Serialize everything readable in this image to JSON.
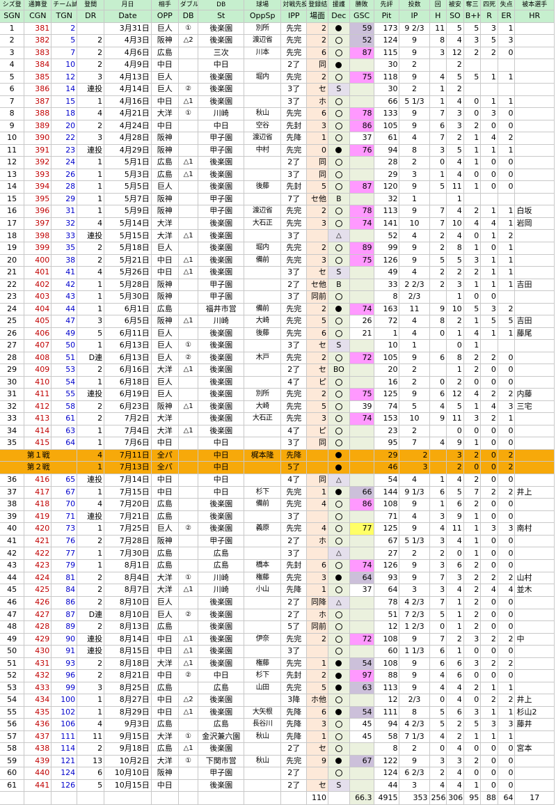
{
  "headers_jp": [
    "シズ登",
    "通算登",
    "チーム試",
    "登間",
    "月日",
    "相手",
    "ダブル",
    "DB",
    "球場",
    "対戦先投",
    "登録結果",
    "援護",
    "勝敗",
    "先評",
    "投数",
    "回",
    "被安",
    "奪三",
    "四死",
    "失点",
    "自責",
    "被本選手"
  ],
  "headers_en": [
    "SGN",
    "CGN",
    "TGN",
    "DR",
    "Date",
    "OPP",
    "DB",
    "St",
    "OppSp",
    "IPP",
    "場面",
    "Dec",
    "GSC",
    "Pit",
    "IP",
    "H",
    "SO",
    "B+H",
    "R",
    "ER",
    "HR"
  ],
  "rows": [
    [
      "1",
      "381",
      "2",
      "",
      "3月31日",
      "巨人",
      "①",
      "後楽園",
      "別所",
      "先完",
      "2",
      "W",
      "59",
      "173",
      "9 2/3",
      "11",
      "5",
      "5",
      "3",
      "1",
      ""
    ],
    [
      "2",
      "382",
      "5",
      "2",
      "4月3日",
      "阪神",
      "△2",
      "後楽園",
      "渡辺省",
      "先完",
      "2",
      "L",
      "52",
      "124",
      "9",
      "8",
      "4",
      "3",
      "5",
      "3",
      ""
    ],
    [
      "3",
      "383",
      "7",
      "2",
      "4月6日",
      "広島",
      "",
      "三次",
      "川本",
      "先完",
      "6",
      "L",
      "87",
      "115",
      "9",
      "3",
      "12",
      "2",
      "2",
      "0",
      ""
    ],
    [
      "4",
      "384",
      "10",
      "2",
      "4月9日",
      "中日",
      "",
      "中日",
      "",
      "2了",
      "同",
      "W",
      "",
      "30",
      "2",
      "",
      "2",
      "",
      "",
      "",
      ""
    ],
    [
      "5",
      "385",
      "12",
      "3",
      "4月13日",
      "巨人",
      "",
      "後楽園",
      "堀内",
      "先完",
      "2",
      "L",
      "75",
      "118",
      "9",
      "4",
      "5",
      "5",
      "1",
      "1",
      ""
    ],
    [
      "6",
      "386",
      "14",
      "連投",
      "4月14日",
      "巨人",
      "②",
      "後楽園",
      "",
      "3了",
      "セ",
      "S",
      "",
      "30",
      "2",
      "1",
      "2",
      "",
      "",
      "",
      ""
    ],
    [
      "7",
      "387",
      "15",
      "1",
      "4月16日",
      "中日",
      "△1",
      "後楽園",
      "",
      "3了",
      "ホ",
      "L",
      "",
      "66",
      "5 1/3",
      "1",
      "4",
      "0",
      "1",
      "1",
      ""
    ],
    [
      "8",
      "388",
      "18",
      "4",
      "4月21日",
      "大洋",
      "①",
      "川崎",
      "秋山",
      "先完",
      "6",
      "L",
      "78",
      "133",
      "9",
      "7",
      "3",
      "0",
      "3",
      "0",
      ""
    ],
    [
      "9",
      "389",
      "20",
      "2",
      "4月24日",
      "中日",
      "",
      "中日",
      "空谷",
      "先封",
      "3",
      "L",
      "86",
      "105",
      "9",
      "6",
      "3",
      "2",
      "0",
      "0",
      ""
    ],
    [
      "10",
      "390",
      "22",
      "3",
      "4月28日",
      "阪神",
      "",
      "甲子園",
      "渡辺省",
      "先降",
      "1",
      "L",
      "37",
      "61",
      "4",
      "7",
      "2",
      "1",
      "4",
      "2",
      ""
    ],
    [
      "11",
      "391",
      "23",
      "連投",
      "4月29日",
      "阪神",
      "",
      "甲子園",
      "中村",
      "先完",
      "0",
      "W",
      "76",
      "94",
      "8",
      "3",
      "5",
      "1",
      "1",
      "1",
      ""
    ],
    [
      "12",
      "392",
      "24",
      "1",
      "5月1日",
      "広島",
      "△1",
      "後楽園",
      "",
      "2了",
      "同",
      "L",
      "",
      "28",
      "2",
      "0",
      "4",
      "1",
      "0",
      "0",
      ""
    ],
    [
      "13",
      "393",
      "26",
      "1",
      "5月3日",
      "広島",
      "△1",
      "後楽園",
      "",
      "3了",
      "同",
      "L",
      "",
      "29",
      "3",
      "1",
      "4",
      "0",
      "0",
      "0",
      ""
    ],
    [
      "14",
      "394",
      "28",
      "1",
      "5月5日",
      "巨人",
      "",
      "後楽園",
      "後藤",
      "先封",
      "5",
      "L",
      "87",
      "120",
      "9",
      "5",
      "11",
      "1",
      "0",
      "0",
      ""
    ],
    [
      "15",
      "395",
      "29",
      "1",
      "5月7日",
      "阪神",
      "",
      "甲子園",
      "",
      "7了",
      "セ他",
      "B",
      "",
      "32",
      "1",
      "",
      "1",
      "",
      "",
      "",
      ""
    ],
    [
      "16",
      "396",
      "31",
      "1",
      "5月9日",
      "阪神",
      "",
      "甲子園",
      "渡辺省",
      "先完",
      "2",
      "L",
      "78",
      "113",
      "9",
      "7",
      "4",
      "2",
      "1",
      "1",
      "白坂"
    ],
    [
      "17",
      "397",
      "32",
      "4",
      "5月14日",
      "大洋",
      "",
      "後楽園",
      "大石正",
      "先完",
      "3",
      "L",
      "74",
      "141",
      "10",
      "7",
      "10",
      "4",
      "4",
      "1",
      "岩岡"
    ],
    [
      "18",
      "398",
      "33",
      "連投",
      "5月15日",
      "大洋",
      "△1",
      "後楽園",
      "",
      "3了",
      "",
      "T",
      "",
      "52",
      "4",
      "2",
      "4",
      "0",
      "1",
      "2",
      ""
    ],
    [
      "19",
      "399",
      "35",
      "2",
      "5月18日",
      "巨人",
      "",
      "後楽園",
      "堀内",
      "先完",
      "2",
      "L",
      "89",
      "99",
      "9",
      "2",
      "8",
      "1",
      "0",
      "1",
      ""
    ],
    [
      "20",
      "400",
      "38",
      "2",
      "5月21日",
      "中日",
      "△1",
      "後楽園",
      "備前",
      "先完",
      "3",
      "L",
      "75",
      "126",
      "9",
      "5",
      "5",
      "3",
      "1",
      "1",
      ""
    ],
    [
      "21",
      "401",
      "41",
      "4",
      "5月26日",
      "中日",
      "△1",
      "後楽園",
      "",
      "3了",
      "セ",
      "S",
      "",
      "49",
      "4",
      "2",
      "2",
      "2",
      "1",
      "1",
      ""
    ],
    [
      "22",
      "402",
      "42",
      "1",
      "5月28日",
      "阪神",
      "",
      "甲子園",
      "",
      "2了",
      "セ他",
      "B",
      "",
      "33",
      "2 2/3",
      "2",
      "3",
      "1",
      "1",
      "1",
      "吉田"
    ],
    [
      "23",
      "403",
      "43",
      "1",
      "5月30日",
      "阪神",
      "",
      "甲子園",
      "",
      "3了",
      "同前",
      "L",
      "",
      "8",
      "2/3",
      "",
      "1",
      "0",
      "0",
      "",
      ""
    ],
    [
      "24",
      "404",
      "44",
      "1",
      "6月1日",
      "広島",
      "",
      "福井市営",
      "備前",
      "先完",
      "2",
      "W",
      "74",
      "163",
      "11",
      "9",
      "10",
      "5",
      "3",
      "2",
      ""
    ],
    [
      "25",
      "405",
      "47",
      "3",
      "6月5日",
      "阪神",
      "△1",
      "川崎",
      "大崎",
      "先完",
      "5",
      "L",
      "26",
      "72",
      "4",
      "8",
      "2",
      "1",
      "5",
      "5",
      "吉田"
    ],
    [
      "26",
      "406",
      "49",
      "5",
      "6月11日",
      "巨人",
      "",
      "後楽園",
      "後藤",
      "先完",
      "6",
      "L",
      "21",
      "1",
      "4",
      "0",
      "1",
      "4",
      "1",
      "1",
      "藤尾"
    ],
    [
      "27",
      "407",
      "50",
      "1",
      "6月13日",
      "巨人",
      "①",
      "後楽園",
      "",
      "3了",
      "セ",
      "S",
      "",
      "10",
      "1",
      "",
      "0",
      "1",
      "",
      "",
      ""
    ],
    [
      "28",
      "408",
      "51",
      "D連",
      "6月13日",
      "巨人",
      "②",
      "後楽園",
      "木戸",
      "先完",
      "2",
      "L",
      "72",
      "105",
      "9",
      "6",
      "8",
      "2",
      "2",
      "0",
      ""
    ],
    [
      "29",
      "409",
      "53",
      "2",
      "6月16日",
      "大洋",
      "△1",
      "後楽園",
      "",
      "2了",
      "セ",
      "BO",
      "",
      "20",
      "2",
      "",
      "1",
      "2",
      "0",
      "0",
      ""
    ],
    [
      "30",
      "410",
      "54",
      "1",
      "6月18日",
      "巨人",
      "",
      "後楽園",
      "",
      "4了",
      "ピ",
      "L",
      "",
      "16",
      "2",
      "0",
      "2",
      "0",
      "0",
      "0",
      ""
    ],
    [
      "31",
      "411",
      "55",
      "連投",
      "6月19日",
      "巨人",
      "",
      "後楽園",
      "別所",
      "先完",
      "2",
      "L",
      "75",
      "125",
      "9",
      "6",
      "12",
      "4",
      "2",
      "2",
      "内藤"
    ],
    [
      "32",
      "412",
      "58",
      "2",
      "6月23日",
      "阪神",
      "△1",
      "後楽園",
      "大崎",
      "先完",
      "5",
      "L",
      "39",
      "74",
      "5",
      "4",
      "5",
      "1",
      "4",
      "3",
      "三宅"
    ],
    [
      "33",
      "413",
      "61",
      "2",
      "7月2日",
      "大洋",
      "",
      "後楽園",
      "大石正",
      "先完",
      "3",
      "L",
      "74",
      "153",
      "10",
      "9",
      "11",
      "3",
      "2",
      "1",
      ""
    ],
    [
      "34",
      "414",
      "63",
      "1",
      "7月4日",
      "大洋",
      "△1",
      "後楽園",
      "",
      "4了",
      "ピ",
      "L",
      "",
      "23",
      "2",
      "",
      "0",
      "0",
      "0",
      "0",
      ""
    ],
    [
      "35",
      "415",
      "64",
      "1",
      "7月6日",
      "中日",
      "",
      "中日",
      "",
      "3了",
      "同",
      "L",
      "",
      "95",
      "7",
      "4",
      "9",
      "1",
      "0",
      "0",
      ""
    ]
  ],
  "allstar": [
    [
      "第１戦",
      "4",
      "7月11日",
      "全パ",
      "中日",
      "梶本隆",
      "先降",
      "",
      "W",
      "",
      "29",
      "2",
      "",
      "3",
      "2",
      "0",
      "2",
      ""
    ],
    [
      "第２戦",
      "1",
      "7月13日",
      "全パ",
      "中日",
      "",
      "5了",
      "",
      "W",
      "",
      "46",
      "3",
      "",
      "2",
      "0",
      "0",
      "2",
      ""
    ]
  ],
  "rows2": [
    [
      "36",
      "416",
      "65",
      "連投",
      "7月14日",
      "中日",
      "",
      "中日",
      "",
      "4了",
      "同",
      "T",
      "",
      "54",
      "4",
      "1",
      "4",
      "2",
      "0",
      "0",
      ""
    ],
    [
      "37",
      "417",
      "67",
      "1",
      "7月15日",
      "中日",
      "",
      "中日",
      "杉下",
      "先完",
      "1",
      "W",
      "66",
      "144",
      "9 1/3",
      "6",
      "5",
      "7",
      "2",
      "2",
      "井上"
    ],
    [
      "38",
      "418",
      "70",
      "4",
      "7月20日",
      "広島",
      "",
      "後楽園",
      "備前",
      "先完",
      "4",
      "L",
      "86",
      "108",
      "9",
      "1",
      "6",
      "2",
      "0",
      "0",
      ""
    ],
    [
      "39",
      "419",
      "71",
      "連投",
      "7月21日",
      "広島",
      "",
      "後楽園",
      "",
      "3了",
      "",
      "L",
      "",
      "71",
      "4",
      "3",
      "9",
      "1",
      "0",
      "0",
      ""
    ],
    [
      "40",
      "420",
      "73",
      "1",
      "7月25日",
      "巨人",
      "②",
      "後楽園",
      "義原",
      "先完",
      "4",
      "L",
      "77",
      "125",
      "9",
      "4",
      "11",
      "1",
      "3",
      "3",
      "南村"
    ],
    [
      "41",
      "421",
      "76",
      "2",
      "7月28日",
      "阪神",
      "",
      "甲子園",
      "",
      "2了",
      "ホ",
      "L",
      "",
      "67",
      "5 1/3",
      "3",
      "4",
      "1",
      "0",
      "0",
      ""
    ],
    [
      "42",
      "422",
      "77",
      "1",
      "7月30日",
      "広島",
      "",
      "広島",
      "",
      "3了",
      "",
      "T",
      "",
      "27",
      "2",
      "2",
      "0",
      "1",
      "0",
      "0",
      ""
    ],
    [
      "43",
      "423",
      "79",
      "1",
      "8月1日",
      "広島",
      "",
      "広島",
      "橋本",
      "先封",
      "6",
      "L",
      "74",
      "126",
      "9",
      "3",
      "6",
      "2",
      "0",
      "0",
      ""
    ],
    [
      "44",
      "424",
      "81",
      "2",
      "8月4日",
      "大洋",
      "①",
      "川崎",
      "権藤",
      "先完",
      "3",
      "W",
      "64",
      "93",
      "9",
      "7",
      "3",
      "2",
      "2",
      "2",
      "山村"
    ],
    [
      "45",
      "425",
      "84",
      "2",
      "8月7日",
      "大洋",
      "△1",
      "川崎",
      "小山",
      "先降",
      "1",
      "L",
      "37",
      "64",
      "3",
      "3",
      "4",
      "2",
      "4",
      "4",
      "並木"
    ],
    [
      "46",
      "426",
      "86",
      "2",
      "8月10日",
      "巨人",
      "",
      "後楽園",
      "",
      "2了",
      "同降",
      "T",
      "",
      "78",
      "4 2/3",
      "7",
      "1",
      "2",
      "0",
      "0",
      ""
    ],
    [
      "47",
      "427",
      "87",
      "D連",
      "8月10日",
      "巨人",
      "②",
      "後楽園",
      "",
      "2了",
      "ホ",
      "L",
      "",
      "51",
      "7 2/3",
      "5",
      "1",
      "2",
      "0",
      "0",
      ""
    ],
    [
      "48",
      "428",
      "89",
      "2",
      "8月13日",
      "広島",
      "",
      "後楽園",
      "",
      "5了",
      "同前",
      "L",
      "",
      "12",
      "1 2/3",
      "0",
      "1",
      "2",
      "0",
      "0",
      ""
    ],
    [
      "49",
      "429",
      "90",
      "連投",
      "8月14日",
      "中日",
      "△1",
      "後楽園",
      "伊奈",
      "先完",
      "2",
      "L",
      "72",
      "108",
      "9",
      "7",
      "2",
      "3",
      "2",
      "2",
      "中"
    ],
    [
      "50",
      "430",
      "91",
      "連投",
      "8月15日",
      "中日",
      "△1",
      "後楽園",
      "",
      "3了",
      "",
      "L",
      "",
      "60",
      "1 1/3",
      "6",
      "1",
      "0",
      "0",
      "0",
      ""
    ],
    [
      "51",
      "431",
      "93",
      "2",
      "8月18日",
      "大洋",
      "△1",
      "後楽園",
      "権藤",
      "先完",
      "1",
      "W",
      "54",
      "108",
      "9",
      "6",
      "6",
      "3",
      "2",
      "2",
      ""
    ],
    [
      "52",
      "432",
      "96",
      "2",
      "8月21日",
      "中日",
      "②",
      "中日",
      "杉下",
      "先封",
      "2",
      "W",
      "97",
      "88",
      "9",
      "4",
      "6",
      "0",
      "0",
      "0",
      ""
    ],
    [
      "53",
      "433",
      "99",
      "3",
      "8月25日",
      "広島",
      "",
      "広島",
      "山田",
      "先完",
      "5",
      "W",
      "63",
      "113",
      "9",
      "4",
      "4",
      "2",
      "1",
      "1",
      ""
    ],
    [
      "54",
      "434",
      "100",
      "1",
      "8月27日",
      "中日",
      "△2",
      "後楽園",
      "",
      "3降",
      "ホ他",
      "L",
      "",
      "12",
      "2/3",
      "0",
      "4",
      "0",
      "2",
      "2",
      "井上"
    ],
    [
      "55",
      "435",
      "102",
      "1",
      "8月29日",
      "中日",
      "△1",
      "後楽園",
      "大矢根",
      "先降",
      "6",
      "W",
      "54",
      "111",
      "8",
      "5",
      "6",
      "3",
      "1",
      "1",
      "杉山2"
    ],
    [
      "56",
      "436",
      "106",
      "4",
      "9月3日",
      "広島",
      "",
      "広島",
      "長谷川",
      "先降",
      "3",
      "L",
      "45",
      "94",
      "4 2/3",
      "5",
      "2",
      "5",
      "3",
      "3",
      "藤井"
    ],
    [
      "57",
      "437",
      "111",
      "11",
      "9月15日",
      "大洋",
      "①",
      "金沢兼六園",
      "秋山",
      "先降",
      "1",
      "L",
      "45",
      "58",
      "7 1/3",
      "4",
      "2",
      "1",
      "1",
      "1",
      ""
    ],
    [
      "58",
      "438",
      "114",
      "2",
      "9月18日",
      "広島",
      "△1",
      "後楽園",
      "",
      "2了",
      "セ",
      "L",
      "",
      "8",
      "2",
      "0",
      "4",
      "0",
      "0",
      "0",
      "宮本"
    ],
    [
      "59",
      "439",
      "121",
      "13",
      "10月2日",
      "大洋",
      "①",
      "下関市営",
      "秋山",
      "先完",
      "9",
      "W",
      "67",
      "122",
      "9",
      "3",
      "3",
      "2",
      "0",
      "0",
      ""
    ],
    [
      "60",
      "440",
      "124",
      "6",
      "10月10日",
      "阪神",
      "",
      "甲子園",
      "",
      "2了",
      "",
      "L",
      "",
      "124",
      "6 2/3",
      "2",
      "4",
      "0",
      "0",
      "0",
      ""
    ],
    [
      "61",
      "441",
      "126",
      "5",
      "10月15日",
      "中日",
      "",
      "後楽園",
      "",
      "2了",
      "セ",
      "S",
      "",
      "44",
      "3",
      "4",
      "4",
      "1",
      "0",
      "0",
      ""
    ]
  ],
  "totals": [
    "110",
    "66.3",
    "4915",
    "353",
    "256",
    "306",
    "95",
    "88",
    "64",
    "17"
  ]
}
